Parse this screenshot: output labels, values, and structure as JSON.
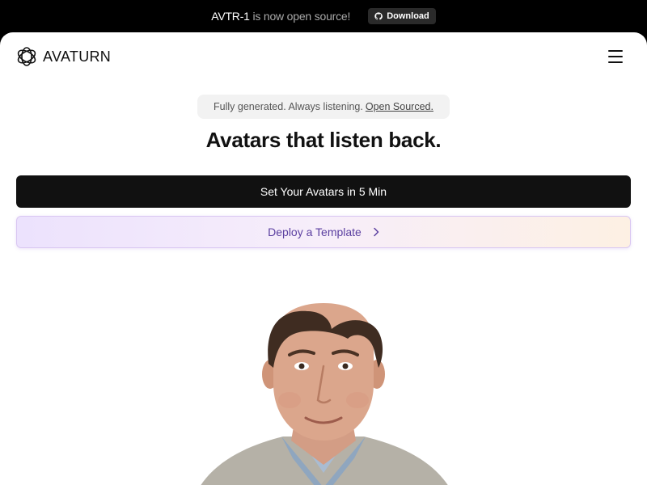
{
  "announcement": {
    "product": "AVTR-1",
    "text": "is now open source!",
    "download_label": "Download",
    "download_icon": "github-icon"
  },
  "nav": {
    "logo_icon": "atom-orbit-icon",
    "logo_text": "AVATURN",
    "menu_icon": "hamburger-menu-icon"
  },
  "hero": {
    "tagline": "Fully generated. Always listening.",
    "tagline_link": "Open Sourced.",
    "headline": "Avatars that listen back.",
    "primary_cta": "Set Your Avatars in 5 Min",
    "secondary_cta": "Deploy a Template",
    "secondary_icon": "chevron-right-icon"
  },
  "colors": {
    "announce_bg": "#000000",
    "primary_btn_bg": "#111111",
    "secondary_text": "#5b3fa0",
    "gradient_start": "#ece2fd",
    "gradient_end": "#fdf0e3"
  }
}
